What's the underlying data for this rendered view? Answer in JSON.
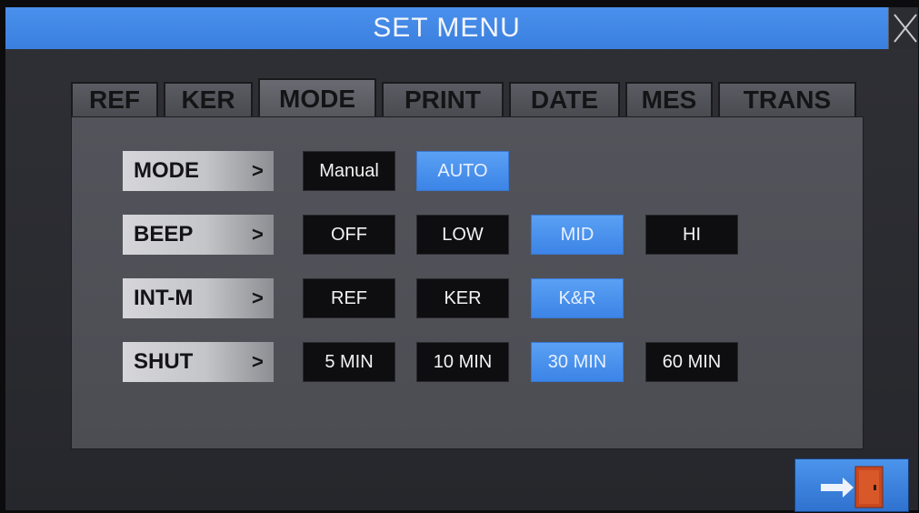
{
  "window": {
    "title": "SET MENU"
  },
  "tabs": [
    {
      "label": "REF",
      "active": false
    },
    {
      "label": "KER",
      "active": false
    },
    {
      "label": "MODE",
      "active": true
    },
    {
      "label": "PRINT",
      "active": false
    },
    {
      "label": "DATE",
      "active": false
    },
    {
      "label": "MES",
      "active": false
    },
    {
      "label": "TRANS",
      "active": false
    }
  ],
  "rows": [
    {
      "label": "MODE",
      "chevron": ">",
      "options": [
        {
          "label": "Manual",
          "selected": false
        },
        {
          "label": "AUTO",
          "selected": true
        }
      ]
    },
    {
      "label": "BEEP",
      "chevron": ">",
      "options": [
        {
          "label": "OFF",
          "selected": false
        },
        {
          "label": "LOW",
          "selected": false
        },
        {
          "label": "MID",
          "selected": true
        },
        {
          "label": "HI",
          "selected": false
        }
      ]
    },
    {
      "label": "INT-M",
      "chevron": ">",
      "options": [
        {
          "label": "REF",
          "selected": false
        },
        {
          "label": "KER",
          "selected": false
        },
        {
          "label": "K&R",
          "selected": true
        }
      ]
    },
    {
      "label": "SHUT",
      "chevron": ">",
      "options": [
        {
          "label": "5 MIN",
          "selected": false
        },
        {
          "label": "10 MIN",
          "selected": false
        },
        {
          "label": "30 MIN",
          "selected": true
        },
        {
          "label": "60 MIN",
          "selected": false
        }
      ]
    }
  ],
  "icons": {
    "close": "close-x-icon",
    "exit": "exit-door-icon"
  },
  "colors": {
    "accent": "#3f86e8",
    "selected": "#4a94f0",
    "option_bg": "#0e0e10"
  }
}
